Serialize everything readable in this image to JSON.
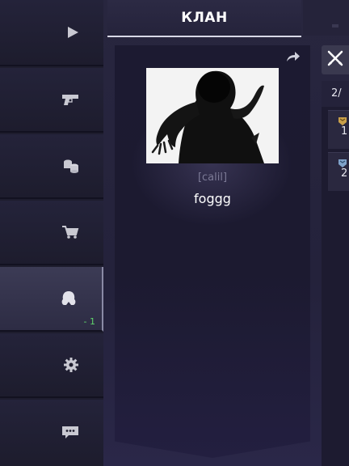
{
  "header": {
    "title": "КЛАН"
  },
  "sidebar": {
    "items": [
      {
        "icon": "play-icon"
      },
      {
        "icon": "pistol-icon"
      },
      {
        "icon": "coins-icon"
      },
      {
        "icon": "cart-icon"
      },
      {
        "icon": "clan-emblem-icon",
        "active": true,
        "count": "- 1"
      },
      {
        "icon": "gear-icon"
      },
      {
        "icon": "chat-icon"
      }
    ]
  },
  "profile": {
    "clan_tag": "[calil]",
    "name": "foggg"
  },
  "right_panel": {
    "member_count": "2/",
    "rows": [
      {
        "value": "1",
        "badge_color": "#c9a04a"
      },
      {
        "value": "2",
        "badge_color": "#7fa2c9"
      }
    ]
  },
  "colors": {
    "accent_green": "#5fd36b",
    "notification": "#e8a838"
  }
}
